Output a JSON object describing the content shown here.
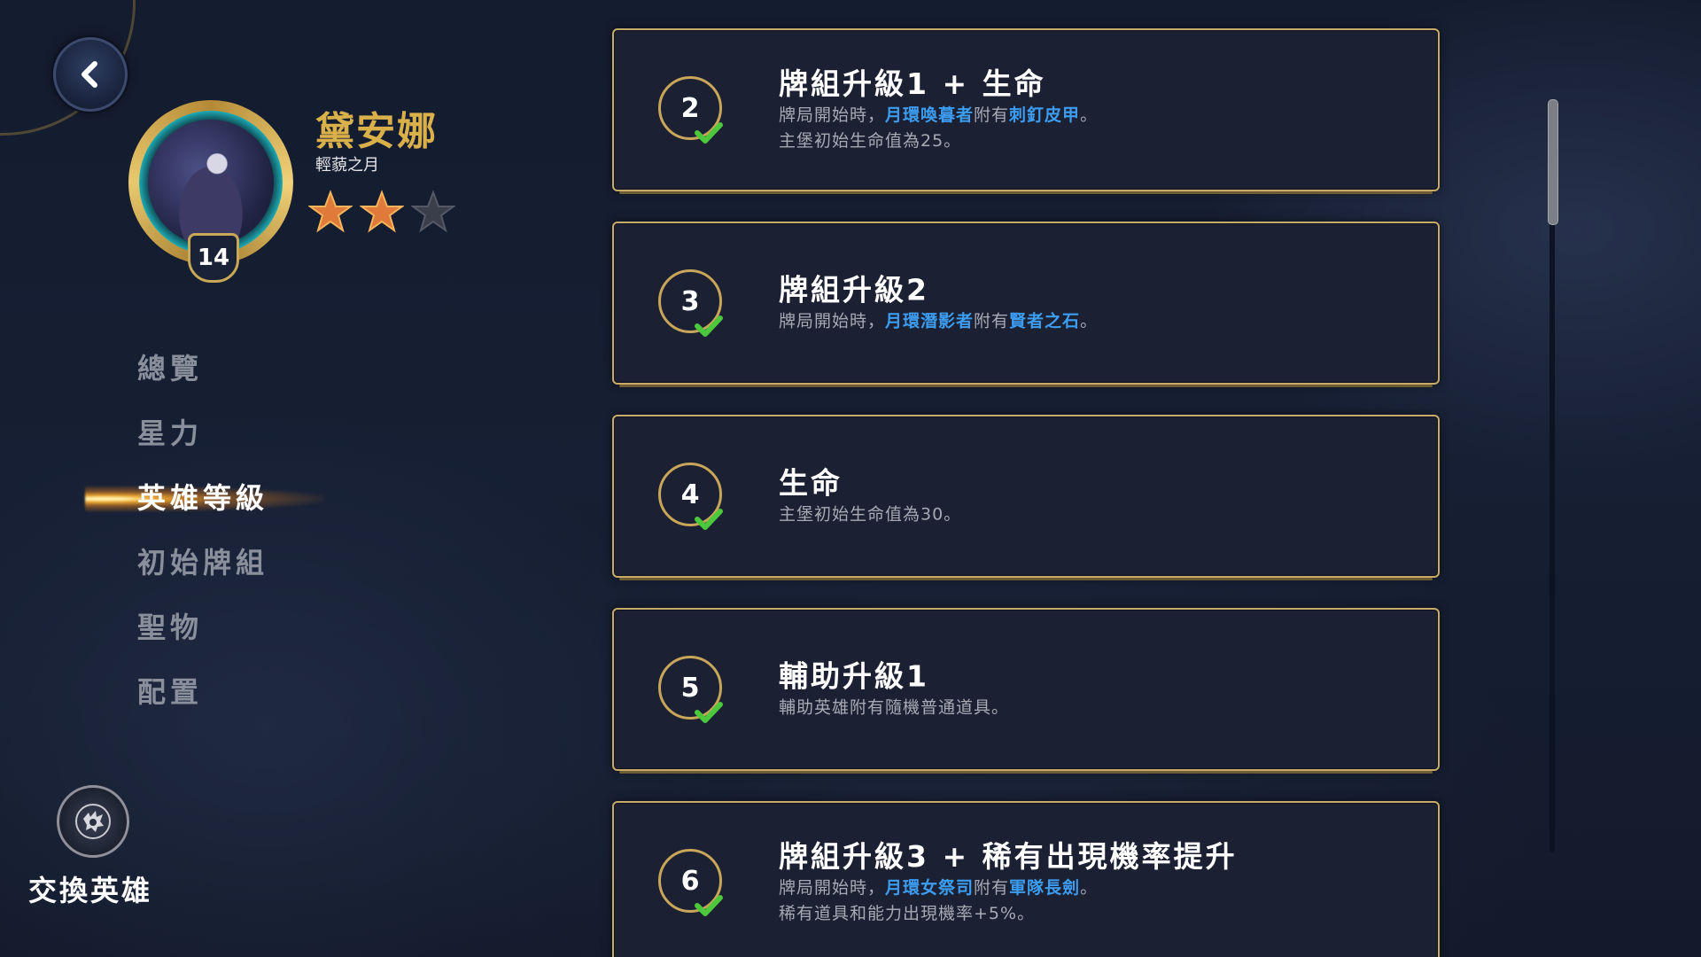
{
  "hero": {
    "name": "黛安娜",
    "title": "輕藐之月",
    "level": "14",
    "stars_filled": 2,
    "stars_total": 3
  },
  "nav": {
    "items": [
      {
        "label": "總覽",
        "active": false
      },
      {
        "label": "星力",
        "active": false
      },
      {
        "label": "英雄等級",
        "active": true
      },
      {
        "label": "初始牌組",
        "active": false
      },
      {
        "label": "聖物",
        "active": false
      },
      {
        "label": "配置",
        "active": false
      }
    ]
  },
  "swap": {
    "label": "交換英雄"
  },
  "levels": [
    {
      "number": "2",
      "title": "牌組升級1 + 生命",
      "lines": [
        [
          {
            "t": "牌局開始時，"
          },
          {
            "t": "月環喚暮者",
            "kw": true
          },
          {
            "t": "附有"
          },
          {
            "t": "刺釘皮甲",
            "kw": true
          },
          {
            "t": "。"
          }
        ],
        [
          {
            "t": "主堡初始生命值為25。"
          }
        ]
      ]
    },
    {
      "number": "3",
      "title": "牌組升級2",
      "lines": [
        [
          {
            "t": "牌局開始時，"
          },
          {
            "t": "月環潛影者",
            "kw": true
          },
          {
            "t": "附有"
          },
          {
            "t": "賢者之石",
            "kw": true
          },
          {
            "t": "。"
          }
        ]
      ]
    },
    {
      "number": "4",
      "title": "生命",
      "lines": [
        [
          {
            "t": "主堡初始生命值為30。"
          }
        ]
      ]
    },
    {
      "number": "5",
      "title": "輔助升級1",
      "lines": [
        [
          {
            "t": "輔助英雄附有隨機普通道具。"
          }
        ]
      ]
    },
    {
      "number": "6",
      "title": "牌組升級3 + 稀有出現機率提升",
      "lines": [
        [
          {
            "t": "牌局開始時，"
          },
          {
            "t": "月環女祭司",
            "kw": true
          },
          {
            "t": "附有"
          },
          {
            "t": "軍隊長劍",
            "kw": true
          },
          {
            "t": "。"
          }
        ],
        [
          {
            "t": "稀有道具和能力出現機率+5%。"
          }
        ]
      ]
    }
  ],
  "colors": {
    "gold": "#d9b04a",
    "keyword_blue": "#3d9df2",
    "check_green": "#4cc83c",
    "card_border": "#c8ab66"
  },
  "icons": {
    "back": "chevron-left-icon",
    "swap": "swap-hero-icon",
    "check": "check-icon",
    "star": "star-icon"
  }
}
